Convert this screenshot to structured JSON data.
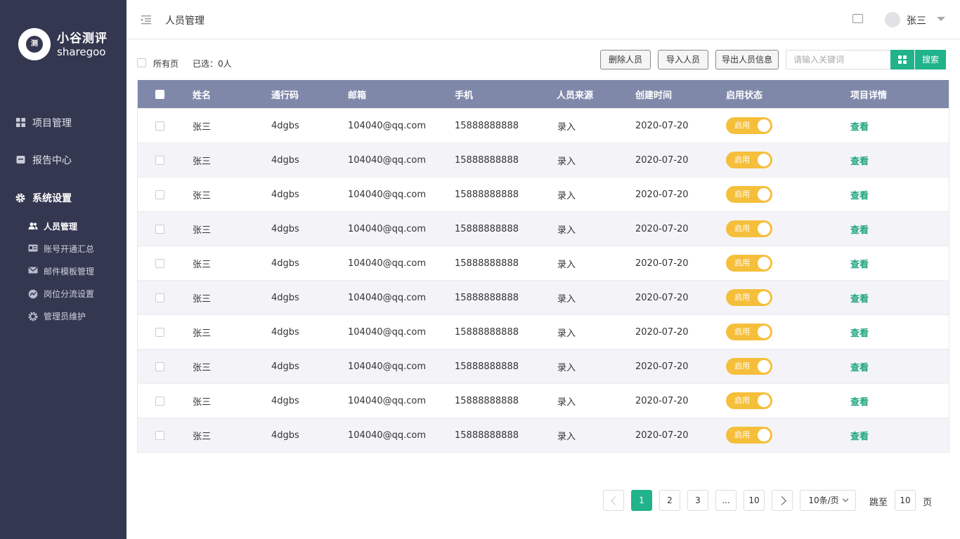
{
  "brand": {
    "name_cn": "小谷测评",
    "name_en": "sharegoo",
    "mark": "测"
  },
  "sidebar": {
    "items": [
      {
        "label": "项目管理",
        "icon": "grid-icon"
      },
      {
        "label": "报告中心",
        "icon": "report-icon"
      },
      {
        "label": "系统设置",
        "icon": "gear-icon"
      }
    ],
    "subitems": [
      {
        "label": "人员管理",
        "icon": "users-icon"
      },
      {
        "label": "账号开通汇总",
        "icon": "id-card-icon"
      },
      {
        "label": "邮件模板管理",
        "icon": "mail-icon"
      },
      {
        "label": "岗位分流设置",
        "icon": "flow-icon"
      },
      {
        "label": "管理员维护",
        "icon": "cog-icon"
      }
    ]
  },
  "header": {
    "title": "人员管理",
    "user": "张三"
  },
  "toolbar": {
    "all_pages": "所有页",
    "selected": "已选：0人",
    "delete_btn": "删除人员",
    "import_btn": "导入人员",
    "export_btn": "导出人员信息",
    "search_placeholder": "请输入关键词",
    "search_btn": "搜索"
  },
  "table": {
    "columns": [
      "姓名",
      "通行码",
      "邮箱",
      "手机",
      "人员来源",
      "创建时间",
      "启用状态",
      "项目详情"
    ],
    "rows": [
      {
        "name": "张三",
        "code": "4dgbs",
        "email": "104040@qq.com",
        "phone": "15888888888",
        "source": "录入",
        "created": "2020-07-20",
        "status": "启用",
        "action": "查看"
      },
      {
        "name": "张三",
        "code": "4dgbs",
        "email": "104040@qq.com",
        "phone": "15888888888",
        "source": "录入",
        "created": "2020-07-20",
        "status": "启用",
        "action": "查看"
      },
      {
        "name": "张三",
        "code": "4dgbs",
        "email": "104040@qq.com",
        "phone": "15888888888",
        "source": "录入",
        "created": "2020-07-20",
        "status": "启用",
        "action": "查看"
      },
      {
        "name": "张三",
        "code": "4dgbs",
        "email": "104040@qq.com",
        "phone": "15888888888",
        "source": "录入",
        "created": "2020-07-20",
        "status": "启用",
        "action": "查看"
      },
      {
        "name": "张三",
        "code": "4dgbs",
        "email": "104040@qq.com",
        "phone": "15888888888",
        "source": "录入",
        "created": "2020-07-20",
        "status": "启用",
        "action": "查看"
      },
      {
        "name": "张三",
        "code": "4dgbs",
        "email": "104040@qq.com",
        "phone": "15888888888",
        "source": "录入",
        "created": "2020-07-20",
        "status": "启用",
        "action": "查看"
      },
      {
        "name": "张三",
        "code": "4dgbs",
        "email": "104040@qq.com",
        "phone": "15888888888",
        "source": "录入",
        "created": "2020-07-20",
        "status": "启用",
        "action": "查看"
      },
      {
        "name": "张三",
        "code": "4dgbs",
        "email": "104040@qq.com",
        "phone": "15888888888",
        "source": "录入",
        "created": "2020-07-20",
        "status": "启用",
        "action": "查看"
      },
      {
        "name": "张三",
        "code": "4dgbs",
        "email": "104040@qq.com",
        "phone": "15888888888",
        "source": "录入",
        "created": "2020-07-20",
        "status": "启用",
        "action": "查看"
      },
      {
        "name": "张三",
        "code": "4dgbs",
        "email": "104040@qq.com",
        "phone": "15888888888",
        "source": "录入",
        "created": "2020-07-20",
        "status": "启用",
        "action": "查看"
      }
    ]
  },
  "pagination": {
    "pages": [
      "1",
      "2",
      "3",
      "...",
      "10"
    ],
    "current": "1",
    "page_size": "10条/页",
    "jump_label": "跳至",
    "jump_value": "10",
    "page_unit": "页"
  },
  "colors": {
    "sidebar_bg": "#343750",
    "accent": "#21b38b",
    "table_header": "#8088aa",
    "toggle_on": "#f5bf3b"
  }
}
